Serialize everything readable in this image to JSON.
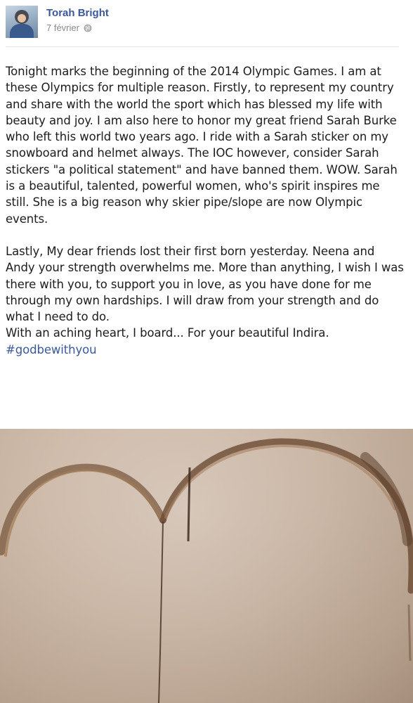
{
  "post": {
    "author": "Torah Bright",
    "date": "7 février",
    "privacy_icon": "globe-icon",
    "paragraph1": "Tonight marks the beginning of the 2014 Olympic Games. I am at these Olympics for multiple reason. Firstly, to represent my country and share with the world the sport which has blessed my life with beauty and joy. I am also here to honor my great friend Sarah Burke who left this world two years ago. I ride with a Sarah sticker on my snowboard and helmet always. The IOC however, consider Sarah stickers \"a political statement\" and have banned them. WOW. Sarah is a beautiful, talented, powerful women, who's spirit inspires me still. She is a big reason why skier pipe/slope are now Olympic events.",
    "paragraph2": "Lastly, My dear friends lost their first born yesterday. Neena and Andy your strength overwhelms me. More than anything, I wish I was there with you, to support you in love, as you have done for me through my own hardships. I will draw from your strength and do what I need to do.",
    "paragraph3": "With an aching heart, I board... For your beautiful Indira.",
    "hashtag": "#godbewithyou"
  },
  "colors": {
    "link": "#3b5998",
    "text": "#1c1c1c",
    "meta": "#8a8a8a"
  }
}
